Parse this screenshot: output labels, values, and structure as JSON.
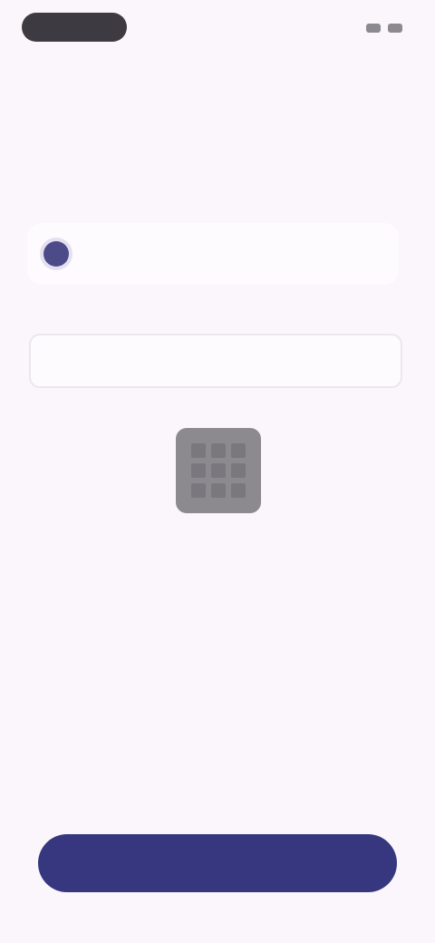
{
  "status_bar": {
    "pill_text": "",
    "right_text": ""
  },
  "nav": {
    "back_label": ""
  },
  "title": "",
  "option": {
    "label": ""
  },
  "input": {
    "label": "",
    "placeholder": "",
    "helper": ""
  },
  "qr": {
    "caption": ""
  },
  "footer": {
    "button_label": ""
  },
  "colors": {
    "background": "#fbf6fc",
    "primary": "#36377e",
    "radio": "#4d4a8a",
    "qr": "#8c898f"
  }
}
